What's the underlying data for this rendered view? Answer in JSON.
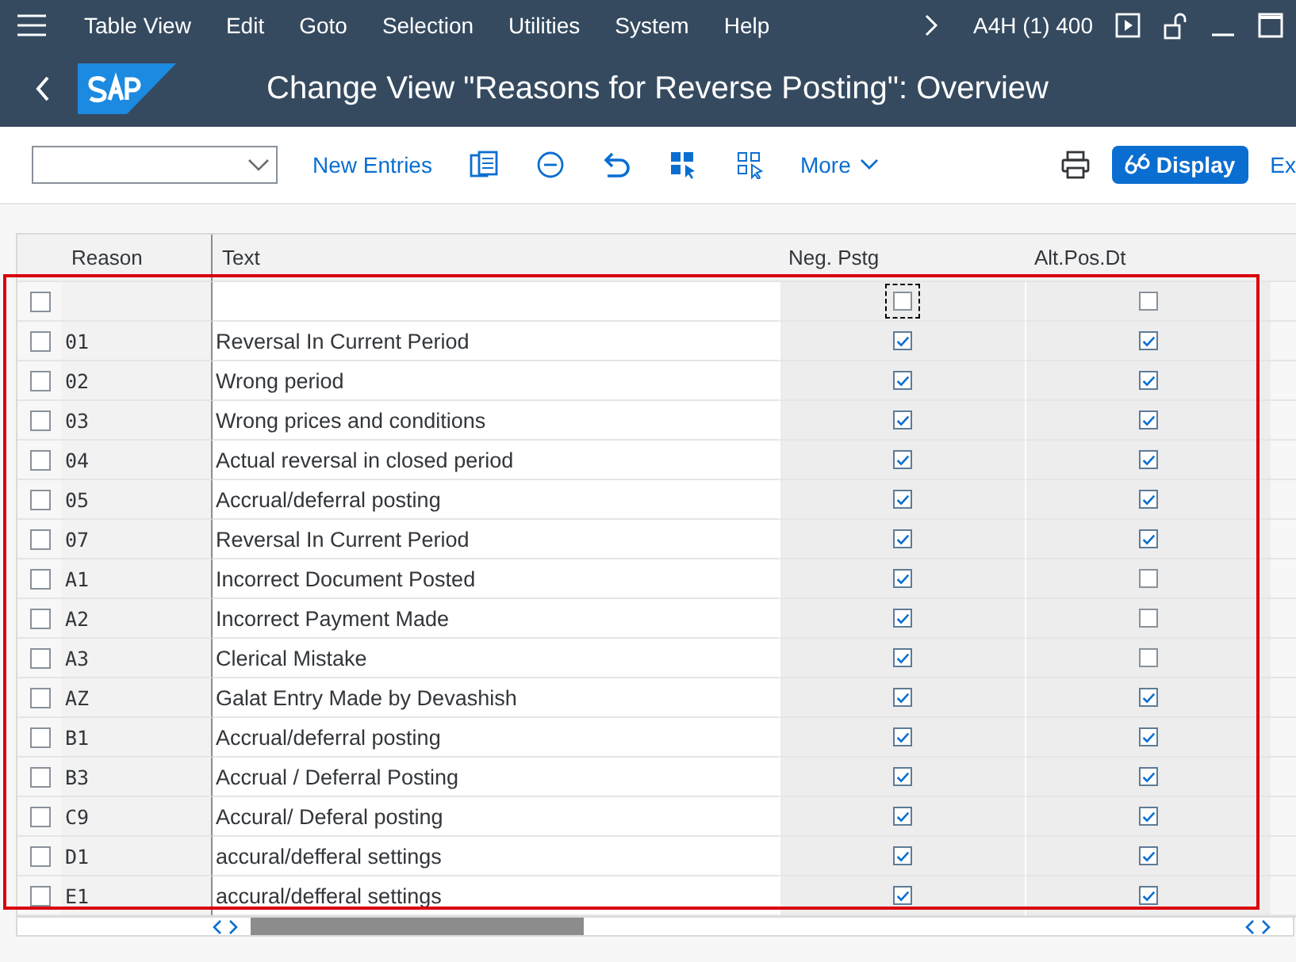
{
  "menu_bar": {
    "items": [
      "Table View",
      "Edit",
      "Goto",
      "Selection",
      "Utilities",
      "System",
      "Help"
    ],
    "system_info": "A4H (1) 400"
  },
  "title_bar": {
    "title": "Change View \"Reasons for Reverse Posting\": Overview"
  },
  "toolbar": {
    "new_entries": "New Entries",
    "more": "More",
    "display": "Display",
    "cut_button": "Ex"
  },
  "table": {
    "columns": [
      "Reason",
      "Text",
      "Neg. Pstg",
      "Alt.Pos.Dt"
    ],
    "rows": [
      {
        "selected": false,
        "reason": "",
        "text": "",
        "neg_pstg": false,
        "alt_pos_dt": false,
        "focused": true
      },
      {
        "selected": false,
        "reason": "01",
        "text": "Reversal In Current Period",
        "neg_pstg": true,
        "alt_pos_dt": true,
        "focused": false
      },
      {
        "selected": false,
        "reason": "02",
        "text": "Wrong period",
        "neg_pstg": true,
        "alt_pos_dt": true,
        "focused": false
      },
      {
        "selected": false,
        "reason": "03",
        "text": "Wrong prices and conditions",
        "neg_pstg": true,
        "alt_pos_dt": true,
        "focused": false
      },
      {
        "selected": false,
        "reason": "04",
        "text": "Actual reversal in closed period",
        "neg_pstg": true,
        "alt_pos_dt": true,
        "focused": false
      },
      {
        "selected": false,
        "reason": "05",
        "text": "Accrual/deferral posting",
        "neg_pstg": true,
        "alt_pos_dt": true,
        "focused": false
      },
      {
        "selected": false,
        "reason": "07",
        "text": "Reversal In Current Period",
        "neg_pstg": true,
        "alt_pos_dt": true,
        "focused": false
      },
      {
        "selected": false,
        "reason": "A1",
        "text": "Incorrect Document Posted",
        "neg_pstg": true,
        "alt_pos_dt": false,
        "focused": false
      },
      {
        "selected": false,
        "reason": "A2",
        "text": "Incorrect Payment Made",
        "neg_pstg": true,
        "alt_pos_dt": false,
        "focused": false
      },
      {
        "selected": false,
        "reason": "A3",
        "text": "Clerical Mistake",
        "neg_pstg": true,
        "alt_pos_dt": false,
        "focused": false
      },
      {
        "selected": false,
        "reason": "AZ",
        "text": "Galat Entry Made by Devashish",
        "neg_pstg": true,
        "alt_pos_dt": true,
        "focused": false
      },
      {
        "selected": false,
        "reason": "B1",
        "text": "Accrual/deferral posting",
        "neg_pstg": true,
        "alt_pos_dt": true,
        "focused": false
      },
      {
        "selected": false,
        "reason": "B3",
        "text": "Accrual / Deferral Posting",
        "neg_pstg": true,
        "alt_pos_dt": true,
        "focused": false
      },
      {
        "selected": false,
        "reason": "C9",
        "text": "Accural/ Deferal posting",
        "neg_pstg": true,
        "alt_pos_dt": true,
        "focused": false
      },
      {
        "selected": false,
        "reason": "D1",
        "text": "accural/defferal settings",
        "neg_pstg": true,
        "alt_pos_dt": true,
        "focused": false
      },
      {
        "selected": false,
        "reason": "E1",
        "text": "accural/defferal settings",
        "neg_pstg": true,
        "alt_pos_dt": true,
        "focused": false
      }
    ]
  },
  "annotation": {
    "highlight": true
  }
}
